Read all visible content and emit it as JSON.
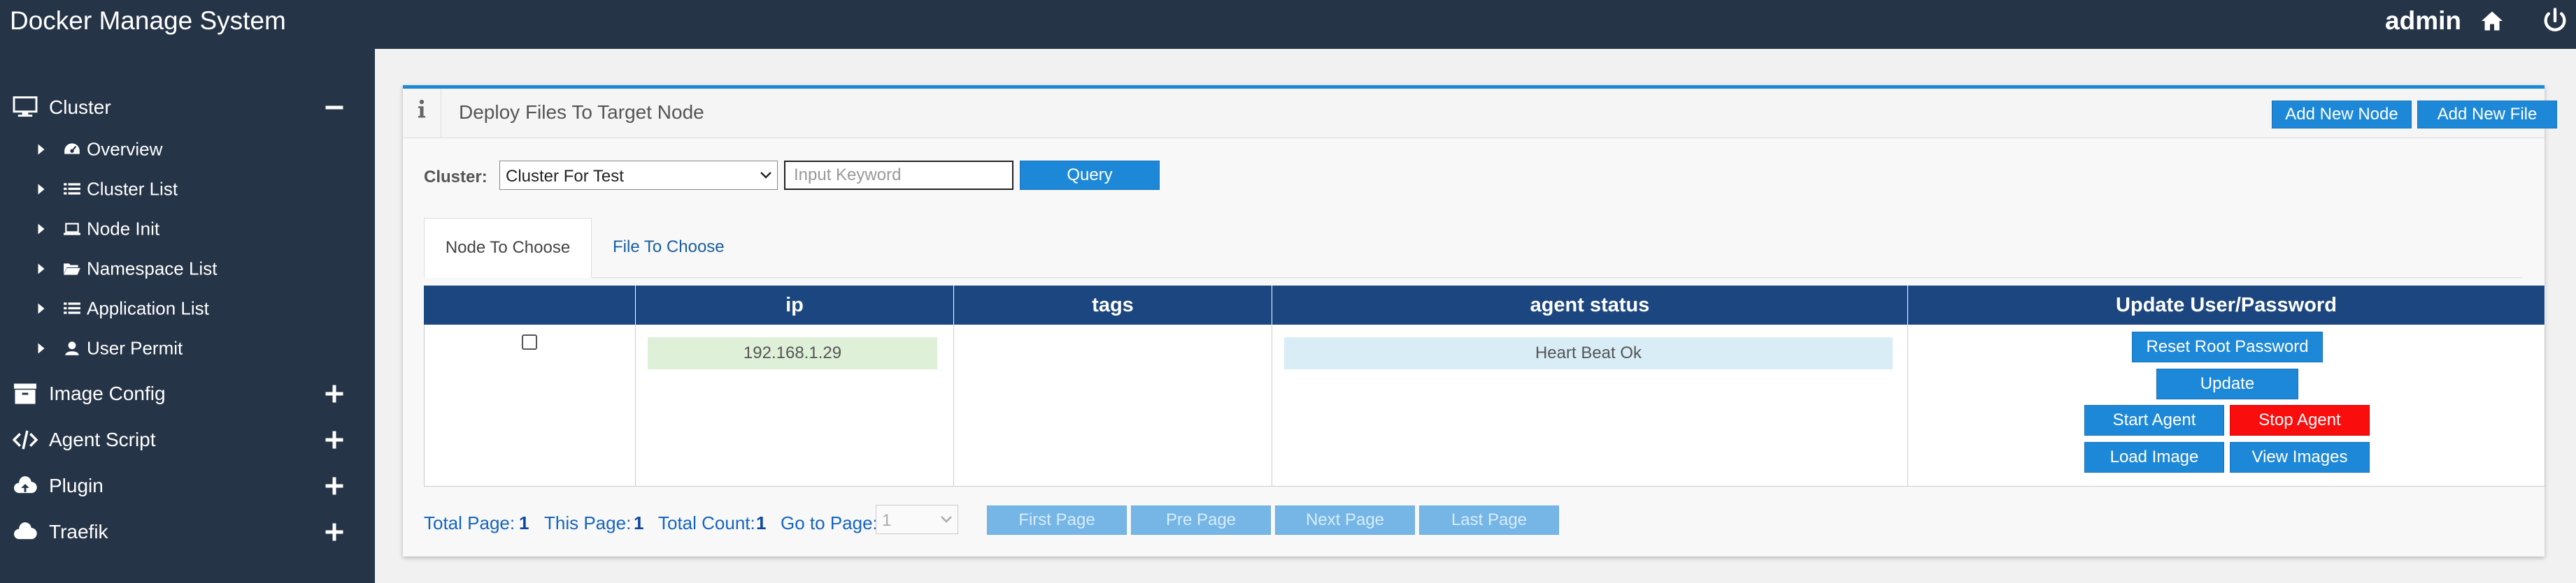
{
  "header": {
    "brand": "Docker Manage System",
    "user": "admin",
    "home_icon": "home-icon",
    "power_icon": "power-icon"
  },
  "sidebar": {
    "groups": [
      {
        "label": "Cluster",
        "icon": "monitor-icon",
        "expanded": true
      },
      {
        "label": "Image Config",
        "icon": "archive-icon",
        "expanded": false
      },
      {
        "label": "Agent Script",
        "icon": "code-icon",
        "expanded": false
      },
      {
        "label": "Plugin",
        "icon": "cloud-upload-icon",
        "expanded": false
      },
      {
        "label": "Traefik",
        "icon": "cloud-icon",
        "expanded": false
      }
    ],
    "cluster_items": [
      {
        "label": "Overview",
        "icon": "dashboard-icon"
      },
      {
        "label": "Cluster List",
        "icon": "list-icon"
      },
      {
        "label": "Node Init",
        "icon": "laptop-icon"
      },
      {
        "label": "Namespace List",
        "icon": "folder-open-icon"
      },
      {
        "label": "Application List",
        "icon": "list-icon"
      },
      {
        "label": "User Permit",
        "icon": "user-icon"
      }
    ]
  },
  "panel": {
    "title": "Deploy Files To Target Node",
    "add_node_label": "Add New Node",
    "add_file_label": "Add New File"
  },
  "filter": {
    "cluster_label": "Cluster:",
    "cluster_selected": "Cluster For Test",
    "keyword_placeholder": "Input Keyword",
    "keyword_value": "",
    "query_label": "Query"
  },
  "tabs": [
    {
      "label": "Node To Choose",
      "active": true
    },
    {
      "label": "File To Choose",
      "active": false
    }
  ],
  "table": {
    "columns": [
      "",
      "ip",
      "tags",
      "agent status",
      "Update User/Password"
    ],
    "rows": [
      {
        "checked": false,
        "ip": "192.168.1.29",
        "tags": "",
        "agent_status": "Heart Beat Ok",
        "actions": {
          "reset_root_password": "Reset Root Password",
          "update": "Update",
          "start_agent": "Start Agent",
          "stop_agent": "Stop Agent",
          "load_image": "Load Image",
          "view_images": "View Images"
        }
      }
    ]
  },
  "pager": {
    "total_page_label": "Total Page:",
    "total_page": "1",
    "this_page_label": "This Page:",
    "this_page": "1",
    "total_count_label": "Total Count:",
    "total_count": "1",
    "go_to_label": "Go to Page:",
    "go_to_value": "1",
    "first_label": "First Page",
    "prev_label": "Pre Page",
    "next_label": "Next Page",
    "last_label": "Last Page"
  },
  "colors": {
    "header_bg": "#253447",
    "accent": "#1e88d8",
    "table_head": "#1b4680",
    "danger": "#fa0d0d",
    "ip_bg": "#dff0d8",
    "status_bg": "#d9edf7"
  }
}
